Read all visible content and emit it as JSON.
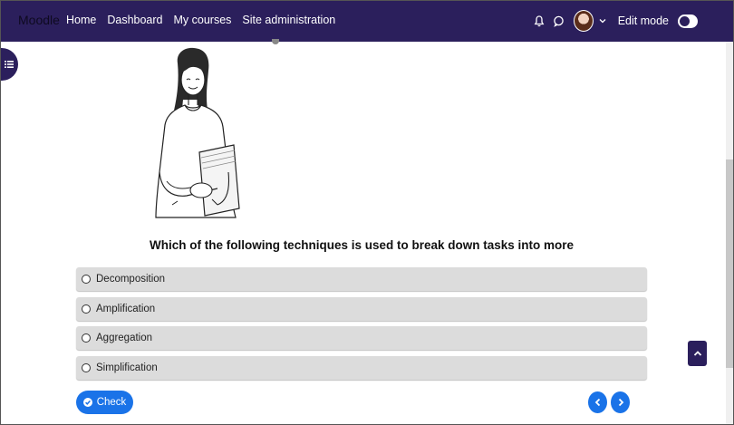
{
  "navbar": {
    "brand": "Moodle",
    "links": [
      "Home",
      "Dashboard",
      "My courses",
      "Site administration"
    ],
    "edit_mode_label": "Edit mode",
    "icons": [
      "bell-icon",
      "chat-icon",
      "avatar",
      "chevron-down-icon"
    ]
  },
  "question": {
    "text": "Which of the following techniques is used to break down tasks into more",
    "options": [
      "Decomposition",
      "Amplification",
      "Aggregation",
      "Simplification"
    ]
  },
  "actions": {
    "check_label": "Check"
  },
  "colors": {
    "navbar": "#2b1f5c",
    "primary": "#1a73e8",
    "option_bg": "#dcdcdc"
  }
}
